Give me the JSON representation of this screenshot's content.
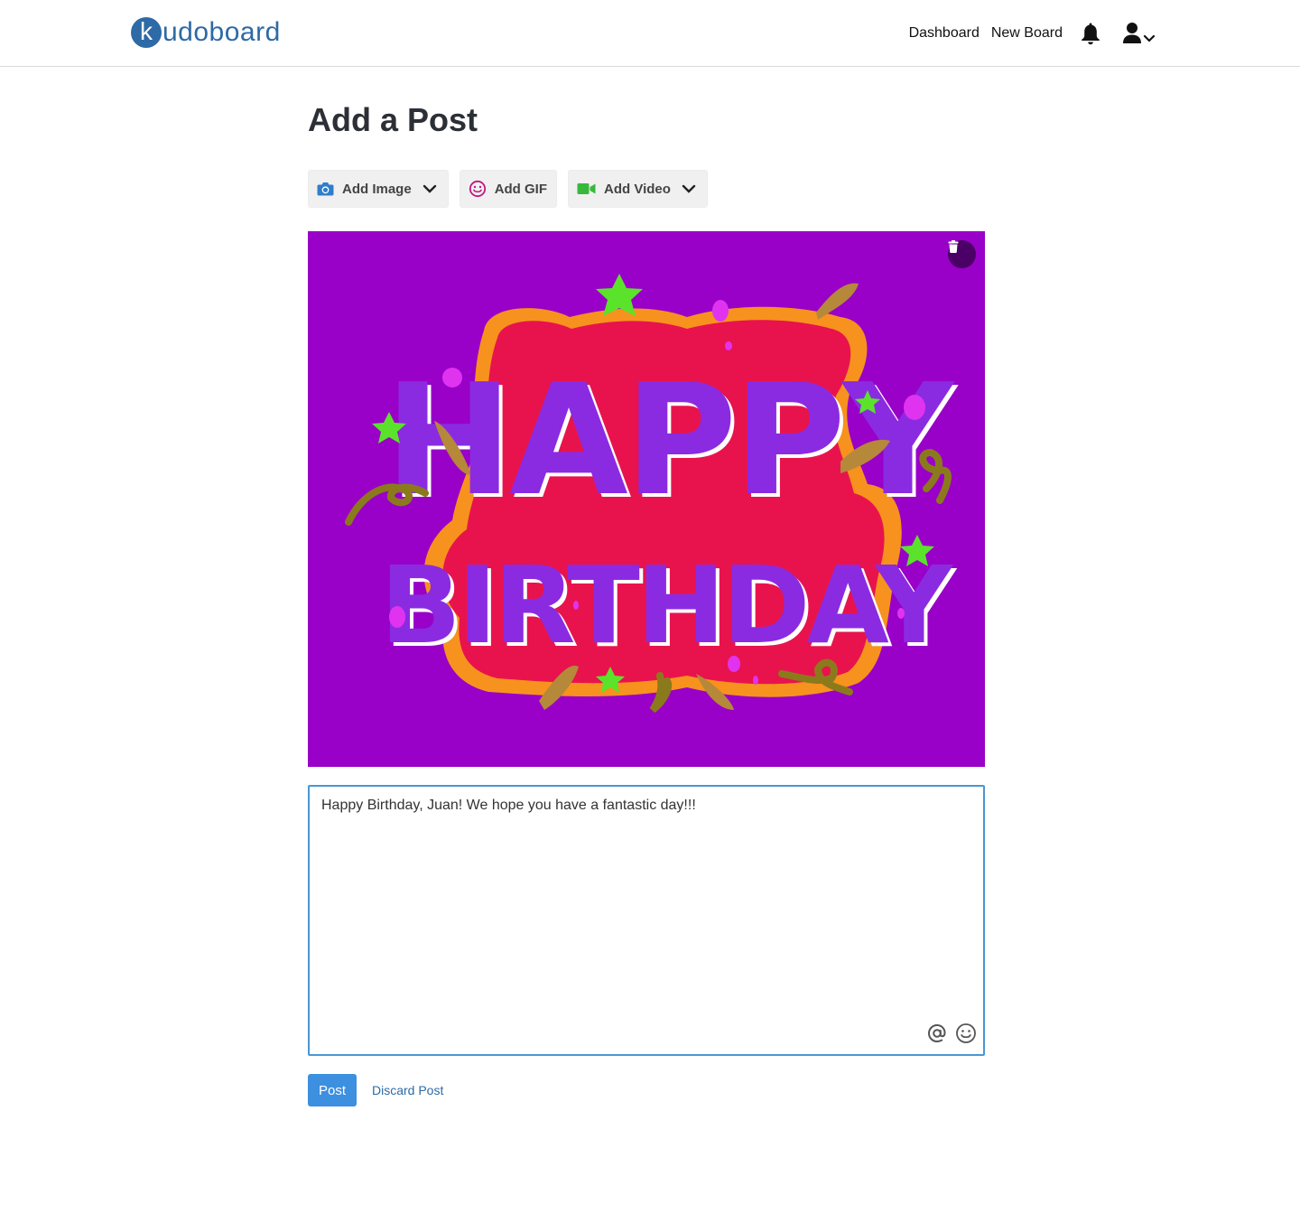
{
  "header": {
    "logo_letter": "k",
    "logo_text": "udoboard",
    "nav": {
      "dashboard": "Dashboard",
      "new_board": "New Board"
    },
    "icons": {
      "notifications": "bell-icon",
      "account": "user-icon",
      "account_menu": "chevron-down-icon"
    }
  },
  "main": {
    "title": "Add a Post",
    "toolbar": {
      "add_image": "Add Image",
      "add_gif": "Add GIF",
      "add_video": "Add Video"
    },
    "media": {
      "gif_text_line1": "HAPPY",
      "gif_text_line2": "BIRTHDAY",
      "background_color": "#9900c8",
      "delete_icon": "trash-icon"
    },
    "message": {
      "text": "Happy Birthday, Juan! We hope you have a fantastic day!!!",
      "tools": {
        "mention": "at-sign-icon",
        "emoji": "smiley-icon"
      }
    },
    "actions": {
      "post": "Post",
      "discard": "Discard Post"
    }
  },
  "colors": {
    "brand": "#2d6aa6",
    "primary_button": "#3d8fdf",
    "focus_border": "#4a97d4"
  }
}
